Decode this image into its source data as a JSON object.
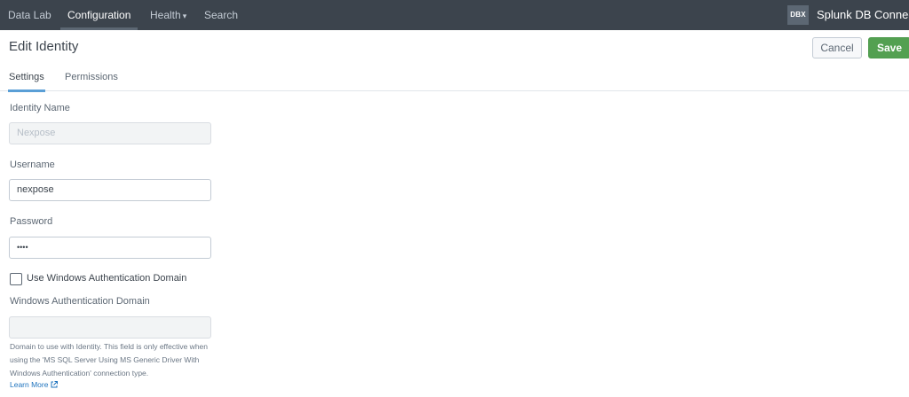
{
  "nav": {
    "items": [
      {
        "label": "Data Lab"
      },
      {
        "label": "Configuration"
      },
      {
        "label": "Health"
      },
      {
        "label": "Search"
      }
    ],
    "health_caret": "▾",
    "app_badge": "DBX",
    "app_name": "Splunk DB Connect"
  },
  "header": {
    "title": "Edit Identity",
    "cancel_label": "Cancel",
    "save_label": "Save"
  },
  "tabs": [
    {
      "label": "Settings",
      "active": true
    },
    {
      "label": "Permissions",
      "active": false
    }
  ],
  "form": {
    "identity_name": {
      "label": "Identity Name",
      "value": "Nexpose",
      "disabled": true
    },
    "username": {
      "label": "Username",
      "value": "nexpose"
    },
    "password": {
      "label": "Password",
      "value": "••••"
    },
    "use_windows_auth": {
      "label": "Use Windows Authentication Domain",
      "checked": false
    },
    "windows_domain": {
      "label": "Windows Authentication Domain",
      "value": "",
      "disabled": true,
      "help_text": "Domain to use with Identity. This field is only effective when using the 'MS SQL Server Using MS Generic Driver With Windows Authentication' connection type.",
      "learn_more": "Learn More"
    }
  },
  "colors": {
    "nav_bg": "#3c444d",
    "accent_save": "#53a051",
    "tab_underline": "#5a9fd6",
    "link": "#1e73be"
  },
  "icons": {
    "learn_more": "external-link-icon",
    "health": "chevron-down-icon"
  }
}
